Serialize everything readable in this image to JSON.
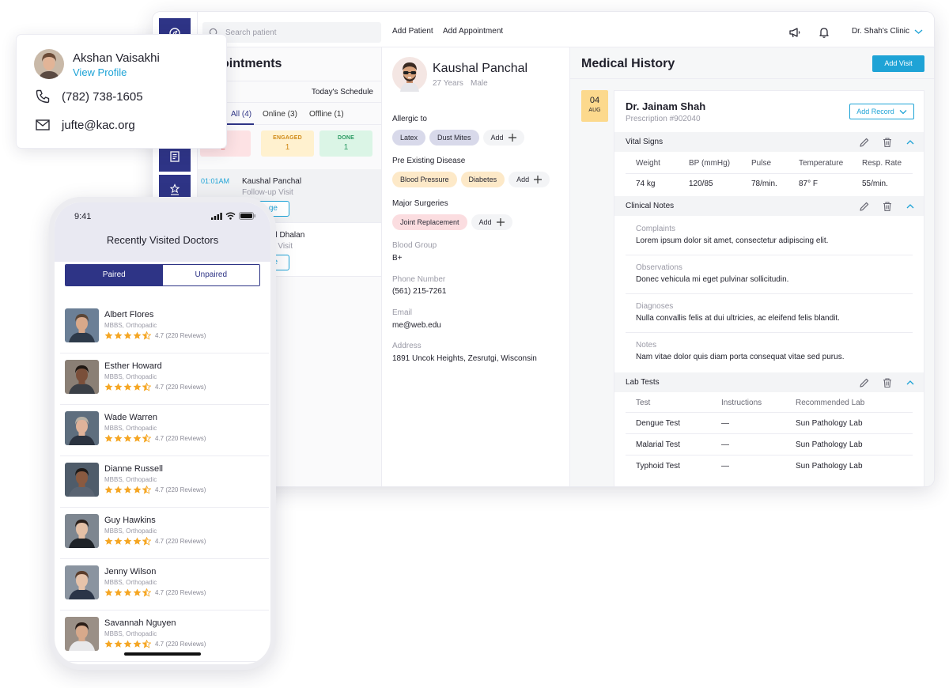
{
  "colors": {
    "primary": "#2e3486",
    "accent": "#1ea3d6",
    "waiting": "#fde2e4",
    "engaged": "#fff1cf",
    "done": "#dbf5e6",
    "date": "#fcd98d"
  },
  "topbar": {
    "search_placeholder": "Search patient",
    "add_patient": "Add Patient",
    "add_appointment": "Add Appointment",
    "clinic": "Dr. Shah's Clinic",
    "icons": [
      "megaphone-icon",
      "bell-icon",
      "chevron-down-icon"
    ]
  },
  "sidebar": {
    "icons": [
      "compass-icon",
      "report-icon",
      "award-icon"
    ]
  },
  "appointments": {
    "title": "Appointments",
    "title_visible": "ointments",
    "schedule": "Today's Schedule",
    "tabs": [
      "All (4)",
      "Online (3)",
      "Offline (1)"
    ],
    "stats": [
      {
        "label": "TING",
        "count": "2"
      },
      {
        "label": "ENGAGED",
        "count": "1"
      },
      {
        "label": "DONE",
        "count": "1"
      }
    ],
    "items": [
      {
        "time": "01:01AM",
        "name": "Kaushal Panchal",
        "type": "Follow-up Visit",
        "button": "ge"
      },
      {
        "time": "",
        "name": "al Dhalan",
        "type": "o Visit",
        "button": "e"
      }
    ]
  },
  "patient": {
    "name": "Kaushal Panchal",
    "age": "27 Years",
    "gender": "Male",
    "allergic_label": "Allergic to",
    "allergies": [
      "Latex",
      "Dust Mites"
    ],
    "disease_label": "Pre Existing Disease",
    "diseases": [
      "Blood Pressure",
      "Diabetes"
    ],
    "surgery_label": "Major Surgeries",
    "surgeries": [
      "Joint Replacement"
    ],
    "add_label": "Add",
    "blood_group_label": "Blood Group",
    "blood_group": "B+",
    "phone_label": "Phone Number",
    "phone": "(561) 215-7261",
    "email_label": "Email",
    "email": "me@web.edu",
    "address_label": "Address",
    "address": "1891 Uncok Heights, Zesrutgi, Wisconsin"
  },
  "history": {
    "title": "Medical History",
    "add_visit": "Add Visit",
    "date_day": "04",
    "date_month": "AUG",
    "doctor": "Dr. Jainam Shah",
    "prescription": "Prescription #902040",
    "add_record": "Add Record",
    "vitals_title": "Vital Signs",
    "vitals_headers": [
      "Weight",
      "BP (mmHg)",
      "Pulse",
      "Temperature",
      "Resp. Rate"
    ],
    "vitals_values": [
      "74 kg",
      "120/85",
      "78/min.",
      "87° F",
      "55/min."
    ],
    "notes_title": "Clinical Notes",
    "notes": [
      {
        "label": "Complaints",
        "value": "Lorem ipsum dolor sit amet, consectetur adipiscing elit."
      },
      {
        "label": "Observations",
        "value": "Donec vehicula mi eget pulvinar sollicitudin."
      },
      {
        "label": "Diagnoses",
        "value": "Nulla convallis felis at dui ultricies, ac eleifend felis blandit."
      },
      {
        "label": "Notes",
        "value": "Nam vitae dolor quis diam porta consequat vitae sed purus."
      }
    ],
    "lab_title": "Lab Tests",
    "lab_headers": [
      "Test",
      "Instructions",
      "Recommended Lab"
    ],
    "lab_rows": [
      [
        "Dengue Test",
        "—",
        "Sun Pathology Lab"
      ],
      [
        "Malarial Test",
        "—",
        "Sun Pathology Lab"
      ],
      [
        "Typhoid Test",
        "—",
        "Sun Pathology Lab"
      ]
    ]
  },
  "contact": {
    "name": "Akshan Vaisakhi",
    "link": "View Profile",
    "phone": "(782) 738-1605",
    "email": "jufte@kac.org"
  },
  "phone_app": {
    "time": "9:41",
    "title": "Recently Visited Doctors",
    "seg_on": "Paired",
    "seg_off": "Unpaired",
    "doctors": [
      {
        "name": "Albert Flores",
        "spec": "MBBS, Orthopadic",
        "rating": "4.7 (220 Reviews)",
        "stars": 4.5
      },
      {
        "name": "Esther Howard",
        "spec": "MBBS, Orthopadic",
        "rating": "4.7 (220 Reviews)",
        "stars": 4.5
      },
      {
        "name": "Wade Warren",
        "spec": "MBBS, Orthopadic",
        "rating": "4.7 (220 Reviews)",
        "stars": 4.5
      },
      {
        "name": "Dianne Russell",
        "spec": "MBBS, Orthopadic",
        "rating": "4.7 (220 Reviews)",
        "stars": 4.5
      },
      {
        "name": "Guy Hawkins",
        "spec": "MBBS, Orthopadic",
        "rating": "4.7 (220 Reviews)",
        "stars": 4.5
      },
      {
        "name": "Jenny Wilson",
        "spec": "MBBS, Orthopadic",
        "rating": "4.7 (220 Reviews)",
        "stars": 4.5
      },
      {
        "name": "Savannah Nguyen",
        "spec": "MBBS, Orthopadic",
        "rating": "4.7 (220 Reviews)",
        "stars": 4.5
      }
    ]
  }
}
